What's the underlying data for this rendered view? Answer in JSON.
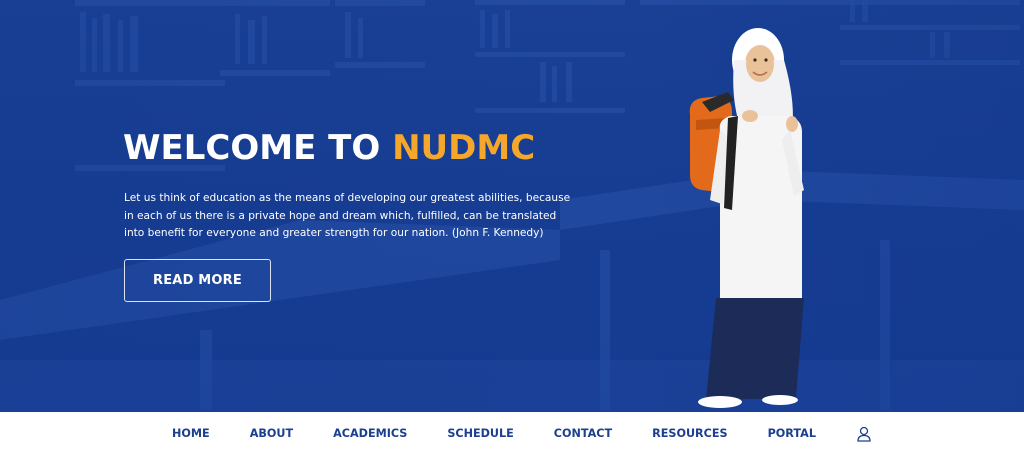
{
  "hero": {
    "title_prefix": "WELCOME TO ",
    "title_accent": "NUDMC",
    "quote": "Let us think of education as the means of developing our greatest abilities, because in each of us there is a private hope and dream which, fulfilled, can be translated into benefit for everyone and greater strength for our nation. (John F. Kennedy)",
    "read_more_label": "READ MORE"
  },
  "nav": {
    "items": [
      {
        "label": "HOME"
      },
      {
        "label": "ABOUT"
      },
      {
        "label": "ACADEMICS"
      },
      {
        "label": "SCHEDULE"
      },
      {
        "label": "CONTACT"
      },
      {
        "label": "RESOURCES"
      },
      {
        "label": "PORTAL"
      }
    ],
    "user_icon": "user-icon"
  },
  "colors": {
    "hero_bg": "#143a8c",
    "accent": "#f5a72b",
    "nav_text": "#1c3f8f",
    "nav_bg": "#ffffff"
  }
}
